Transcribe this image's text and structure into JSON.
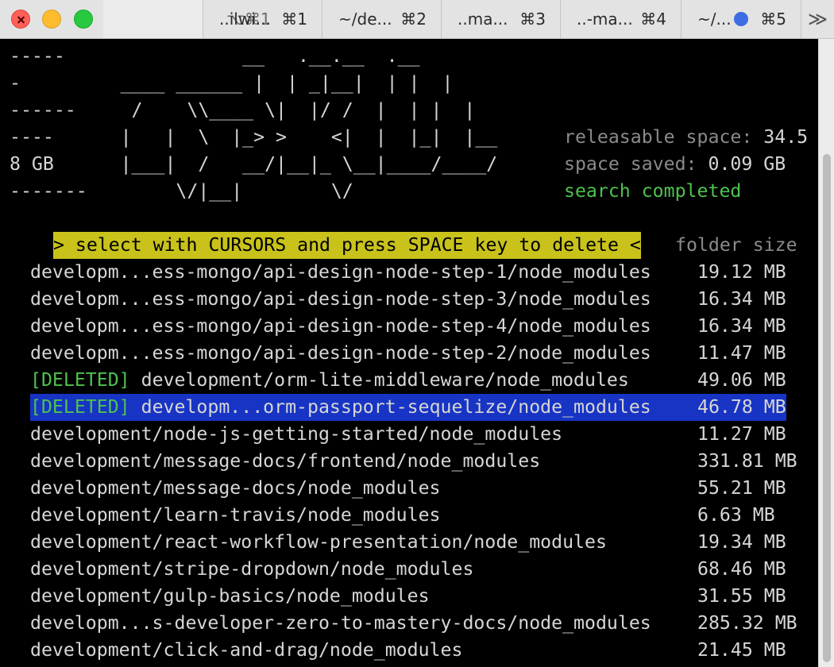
{
  "titlebar": {
    "active_tab_key": "⌥⌘1",
    "tabs": [
      {
        "name": "..ilwi...",
        "key": "⌘1"
      },
      {
        "name": "~/de...",
        "key": "⌘2"
      },
      {
        "name": "..ma...",
        "key": "⌘3"
      },
      {
        "name": "..-ma...",
        "key": "⌘4"
      },
      {
        "name": "~/...",
        "key": "⌘5"
      }
    ],
    "overflow": "≫"
  },
  "banner": {
    "lines": [
      "-----                __   .__.__  .__",
      "-         ____ ______ |  | _|__|  | |  |",
      "------     /    \\\\____ \\|  |/ /  |  | |  |",
      "----      |   |  \\  |_> >    <|  |  |_|  |__",
      "8 GB      |___|  /   __/|__|_ \\__|____/____/",
      "-------        \\/|__|        \\/"
    ]
  },
  "stats": {
    "releasable_label": "releasable space:",
    "releasable_value": "34.5",
    "saved_label": "space saved:",
    "saved_value": "0.09 GB",
    "status": "search completed"
  },
  "header": {
    "instruction": "> select with CURSORS and press SPACE key to delete <",
    "size_col": "folder size"
  },
  "rows": [
    {
      "tag": "",
      "path": "developm...ess-mongo/api-design-node-step-1/node_modules",
      "size": "19.12 MB"
    },
    {
      "tag": "",
      "path": "developm...ess-mongo/api-design-node-step-3/node_modules",
      "size": "16.34 MB"
    },
    {
      "tag": "",
      "path": "developm...ess-mongo/api-design-node-step-4/node_modules",
      "size": "16.34 MB"
    },
    {
      "tag": "",
      "path": "developm...ess-mongo/api-design-node-step-2/node_modules",
      "size": "11.47 MB"
    },
    {
      "tag": "[DELETED]",
      "path": "development/orm-lite-middleware/node_modules",
      "size": "49.06 MB"
    },
    {
      "tag": "[DELETED]",
      "path": "developm...orm-passport-sequelize/node_modules",
      "size": "46.78 MB"
    },
    {
      "tag": "",
      "path": "development/node-js-getting-started/node_modules",
      "size": "11.27 MB"
    },
    {
      "tag": "",
      "path": "development/message-docs/frontend/node_modules",
      "size": "331.81 MB"
    },
    {
      "tag": "",
      "path": "development/message-docs/node_modules",
      "size": "55.21 MB"
    },
    {
      "tag": "",
      "path": "development/learn-travis/node_modules",
      "size": "6.63 MB"
    },
    {
      "tag": "",
      "path": "development/react-workflow-presentation/node_modules",
      "size": "19.34 MB"
    },
    {
      "tag": "",
      "path": "development/stripe-dropdown/node_modules",
      "size": "68.46 MB"
    },
    {
      "tag": "",
      "path": "development/gulp-basics/node_modules",
      "size": "31.55 MB"
    },
    {
      "tag": "",
      "path": "developm...s-developer-zero-to-mastery-docs/node_modules",
      "size": "285.32 MB"
    },
    {
      "tag": "",
      "path": "development/click-and-drag/node_modules",
      "size": "21.45 MB"
    }
  ]
}
